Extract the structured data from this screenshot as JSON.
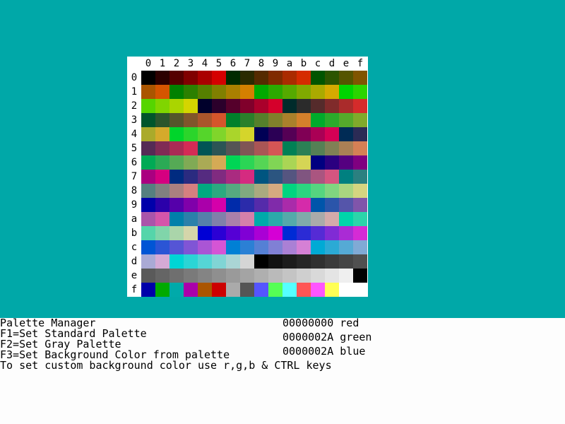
{
  "background_color": "#00a8a8",
  "palette_grid": {
    "col_labels": [
      "0",
      "1",
      "2",
      "3",
      "4",
      "5",
      "6",
      "7",
      "8",
      "9",
      "a",
      "b",
      "c",
      "d",
      "e",
      "f"
    ],
    "row_labels": [
      "0",
      "1",
      "2",
      "3",
      "4",
      "5",
      "6",
      "7",
      "8",
      "9",
      "a",
      "b",
      "c",
      "d",
      "e",
      "f"
    ],
    "rows": [
      [
        "#000000",
        "#2b0000",
        "#550000",
        "#800000",
        "#aa0000",
        "#d50000",
        "#002b00",
        "#2b2b00",
        "#552b00",
        "#802b00",
        "#aa2b00",
        "#d52b00",
        "#005500",
        "#2b5500",
        "#555500",
        "#805500"
      ],
      [
        "#aa5500",
        "#d55500",
        "#008000",
        "#2b8000",
        "#558000",
        "#808000",
        "#aa8000",
        "#d58000",
        "#00aa00",
        "#2baa00",
        "#55aa00",
        "#80aa00",
        "#aaaa00",
        "#d5aa00",
        "#00d500",
        "#2bd500"
      ],
      [
        "#55d500",
        "#80d500",
        "#aad500",
        "#d5d500",
        "#00002b",
        "#2b002b",
        "#55002b",
        "#80002b",
        "#aa002b",
        "#d5002b",
        "#002b2b",
        "#2b2b2b",
        "#552b2b",
        "#802b2b",
        "#aa2b2b",
        "#d52b2b"
      ],
      [
        "#00552b",
        "#2b552b",
        "#55552b",
        "#80552b",
        "#aa552b",
        "#d5552b",
        "#00802b",
        "#2b802b",
        "#55802b",
        "#80802b",
        "#aa802b",
        "#d5802b",
        "#00aa2b",
        "#2baa2b",
        "#55aa2b",
        "#80aa2b"
      ],
      [
        "#aaaa2b",
        "#d5aa2b",
        "#00d52b",
        "#2bd52b",
        "#55d52b",
        "#80d52b",
        "#aad52b",
        "#d5d52b",
        "#000055",
        "#2b0055",
        "#550055",
        "#800055",
        "#aa0055",
        "#d50055",
        "#002b55",
        "#2b2b55"
      ],
      [
        "#552b55",
        "#802b55",
        "#aa2b55",
        "#d52b55",
        "#005555",
        "#2b5555",
        "#555555",
        "#805555",
        "#aa5555",
        "#d55555",
        "#008055",
        "#2b8055",
        "#558055",
        "#808055",
        "#aa8055",
        "#d58055"
      ],
      [
        "#00aa55",
        "#2baa55",
        "#55aa55",
        "#80aa55",
        "#aaaa55",
        "#d5aa55",
        "#00d555",
        "#2bd555",
        "#55d555",
        "#80d555",
        "#aad555",
        "#d5d555",
        "#000080",
        "#2b0080",
        "#550080",
        "#800080"
      ],
      [
        "#aa0080",
        "#d50080",
        "#002b80",
        "#2b2b80",
        "#552b80",
        "#802b80",
        "#aa2b80",
        "#d52b80",
        "#005580",
        "#2b5580",
        "#555580",
        "#805580",
        "#aa5580",
        "#d55580",
        "#008080",
        "#2b8080"
      ],
      [
        "#558080",
        "#808080",
        "#aa8080",
        "#d58080",
        "#00aa80",
        "#2baa80",
        "#55aa80",
        "#80aa80",
        "#aaaa80",
        "#d5aa80",
        "#00d580",
        "#2bd580",
        "#55d580",
        "#80d580",
        "#aad580",
        "#d5d580"
      ],
      [
        "#0000aa",
        "#2b00aa",
        "#5500aa",
        "#8000aa",
        "#aa00aa",
        "#d500aa",
        "#002baa",
        "#2b2baa",
        "#552baa",
        "#802baa",
        "#aa2baa",
        "#d52baa",
        "#0055aa",
        "#2b55aa",
        "#5555aa",
        "#8055aa"
      ],
      [
        "#aa55aa",
        "#d555aa",
        "#0080aa",
        "#2b80aa",
        "#5580aa",
        "#8080aa",
        "#aa80aa",
        "#d580aa",
        "#00aaaa",
        "#2baaaa",
        "#55aaaa",
        "#80aaaa",
        "#aaaaaa",
        "#d5aaaa",
        "#00d5aa",
        "#2bd5aa"
      ],
      [
        "#55d5aa",
        "#80d5aa",
        "#aad5aa",
        "#d5d5aa",
        "#0000d5",
        "#2b00d5",
        "#5500d5",
        "#8000d5",
        "#aa00d5",
        "#d500d5",
        "#002bd5",
        "#2b2bd5",
        "#552bd5",
        "#802bd5",
        "#aa2bd5",
        "#d52bd5"
      ],
      [
        "#0055d5",
        "#2b55d5",
        "#5555d5",
        "#8055d5",
        "#aa55d5",
        "#d555d5",
        "#0080d5",
        "#2b80d5",
        "#5580d5",
        "#8080d5",
        "#aa80d5",
        "#d580d5",
        "#00aad5",
        "#2baad5",
        "#55aad5",
        "#80aad5"
      ],
      [
        "#aaaad5",
        "#d5aad5",
        "#00d5d5",
        "#2bd5d5",
        "#55d5d5",
        "#80d5d5",
        "#aad5d5",
        "#d5d5d5",
        "#000000",
        "#111111",
        "#1c1c1c",
        "#262626",
        "#303030",
        "#3b3b3b",
        "#454545",
        "#505050"
      ],
      [
        "#5a5a5a",
        "#656565",
        "#6f6f6f",
        "#7a7a7a",
        "#848484",
        "#8f8f8f",
        "#9a9a9a",
        "#a4a4a4",
        "#afafaf",
        "#bababa",
        "#c4c4c4",
        "#cfcfcf",
        "#d9d9d9",
        "#e4e4e4",
        "#efefef",
        "#000000"
      ],
      [
        "#0000aa",
        "#00aa00",
        "#00aaaa",
        "#aa00aa",
        "#aa5500",
        "#cc0000",
        "#aaaaaa",
        "#555555",
        "#5555ff",
        "#55ff55",
        "#55ffff",
        "#ff5555",
        "#ff55ff",
        "#ffff55",
        "#ffffff",
        "#ffffff"
      ]
    ]
  },
  "info": {
    "title": "Palette Manager",
    "f1": "F1=Set Standard Palette",
    "f2": "F2=Set Gray Palette",
    "f3": "F3=Set Background Color from palette",
    "custom": "To set custom background color use r,g,b & CTRL keys",
    "red_value": "00000000 red",
    "green_value": "0000002A green",
    "blue_value": "0000002A blue"
  }
}
